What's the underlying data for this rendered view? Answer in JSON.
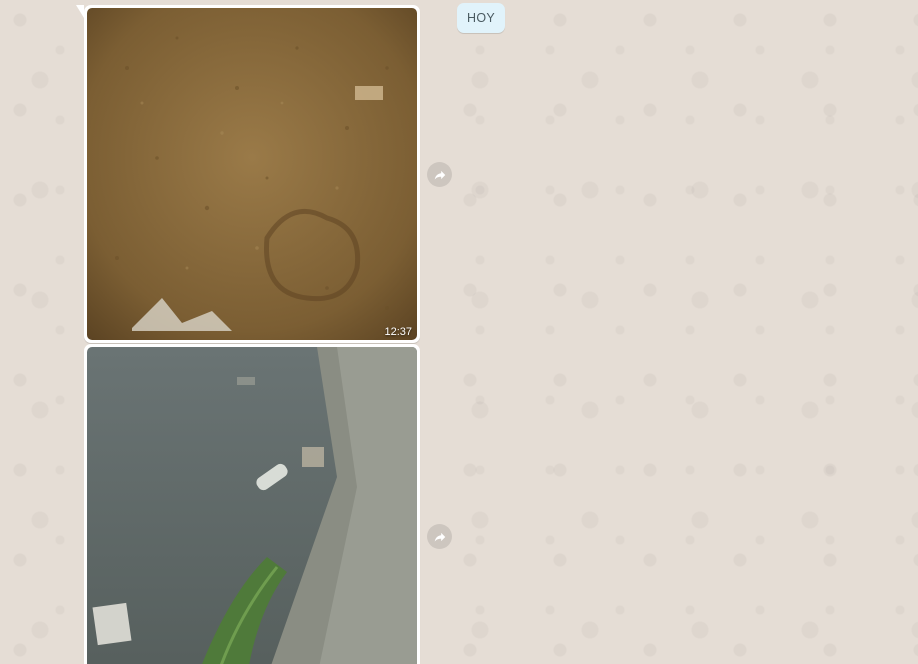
{
  "date_divider": "HOY",
  "messages": [
    {
      "type": "image",
      "time": "12:37",
      "image_icon": "photo-sandy-ground-icon"
    },
    {
      "type": "image",
      "time": "",
      "image_icon": "photo-river-with-litter-icon"
    }
  ],
  "forward_icon": "forward-arrow-icon",
  "colors": {
    "chat_background": "#e5ddd5",
    "bubble": "#ffffff",
    "date_chip": "#e1f3fb"
  }
}
